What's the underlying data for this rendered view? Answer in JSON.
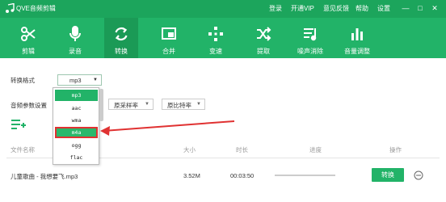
{
  "window": {
    "title": "QVE音频剪辑",
    "menu": [
      "登录",
      "开通VIP",
      "意见反馈",
      "帮助",
      "设置"
    ],
    "controls": [
      "—",
      "□",
      "✕"
    ]
  },
  "toolbar": {
    "tools": [
      {
        "label": "剪辑",
        "icon": "scissors-icon"
      },
      {
        "label": "录音",
        "icon": "microphone-icon"
      },
      {
        "label": "转换",
        "icon": "convert-icon",
        "active": true
      },
      {
        "label": "合并",
        "icon": "merge-icon"
      },
      {
        "label": "变速",
        "icon": "speed-icon"
      },
      {
        "label": "提取",
        "icon": "extract-icon"
      },
      {
        "label": "噪声消除",
        "icon": "denoise-icon"
      },
      {
        "label": "音量调整",
        "icon": "volume-bars-icon"
      }
    ]
  },
  "settings": {
    "format_label": "转换格式",
    "format_value": "mp3",
    "params_label": "音频参数设置",
    "sample_rate": "原采样率",
    "bitrate": "原比特率"
  },
  "format_options": [
    {
      "label": "mp3",
      "state": "selected"
    },
    {
      "label": "aac",
      "state": ""
    },
    {
      "label": "wma",
      "state": ""
    },
    {
      "label": "m4a",
      "state": "highlighted"
    },
    {
      "label": "ogg",
      "state": ""
    },
    {
      "label": "flac",
      "state": ""
    }
  ],
  "table": {
    "headers": [
      "文件名称",
      "大小",
      "时长",
      "进度",
      "操作"
    ],
    "rows": [
      {
        "name": "儿童歌曲 - 我想要飞.mp3",
        "size": "3.52M",
        "duration": "00:03:50",
        "progress": 0,
        "action": "转换"
      }
    ]
  },
  "colors": {
    "brand": "#22b368",
    "brand_dark": "#1ca55c",
    "annotation": "#e03232"
  }
}
